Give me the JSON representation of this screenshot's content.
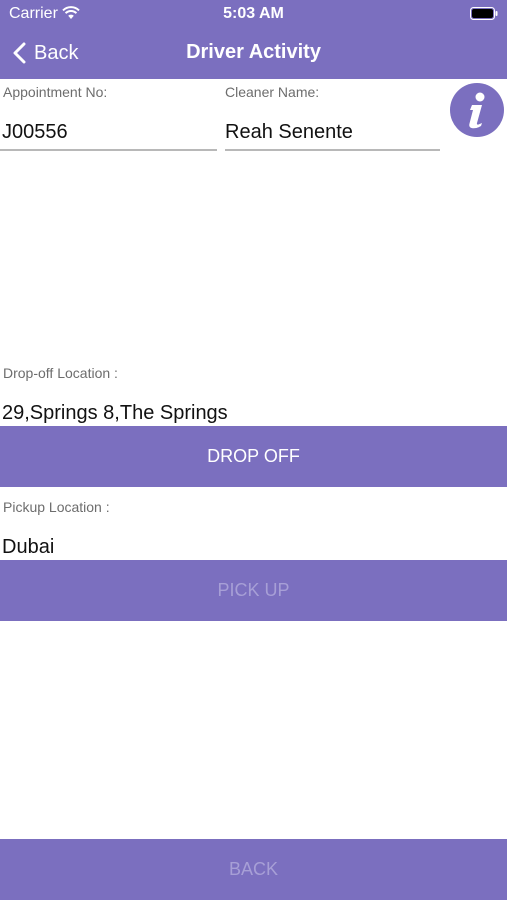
{
  "status_bar": {
    "carrier": "Carrier",
    "time": "5:03 AM"
  },
  "nav": {
    "back_label": "Back",
    "title": "Driver Activity"
  },
  "appointment": {
    "label": "Appointment No:",
    "value": "J00556"
  },
  "cleaner": {
    "label": "Cleaner Name:",
    "value": "Reah Senente"
  },
  "dropoff": {
    "label": "Drop-off Location :",
    "value": "29,Springs 8,The Springs",
    "button_label": "DROP OFF"
  },
  "pickup": {
    "label": "Pickup Location :",
    "value": "Dubai",
    "button_label": "PICK UP"
  },
  "footer": {
    "back_button_label": "BACK"
  },
  "colors": {
    "accent": "#7b6fbf",
    "disabled_text": "#a79fd6"
  },
  "icons": {
    "info": "info-icon",
    "wifi": "wifi-icon",
    "battery": "battery-icon",
    "back": "chevron-left-icon"
  }
}
